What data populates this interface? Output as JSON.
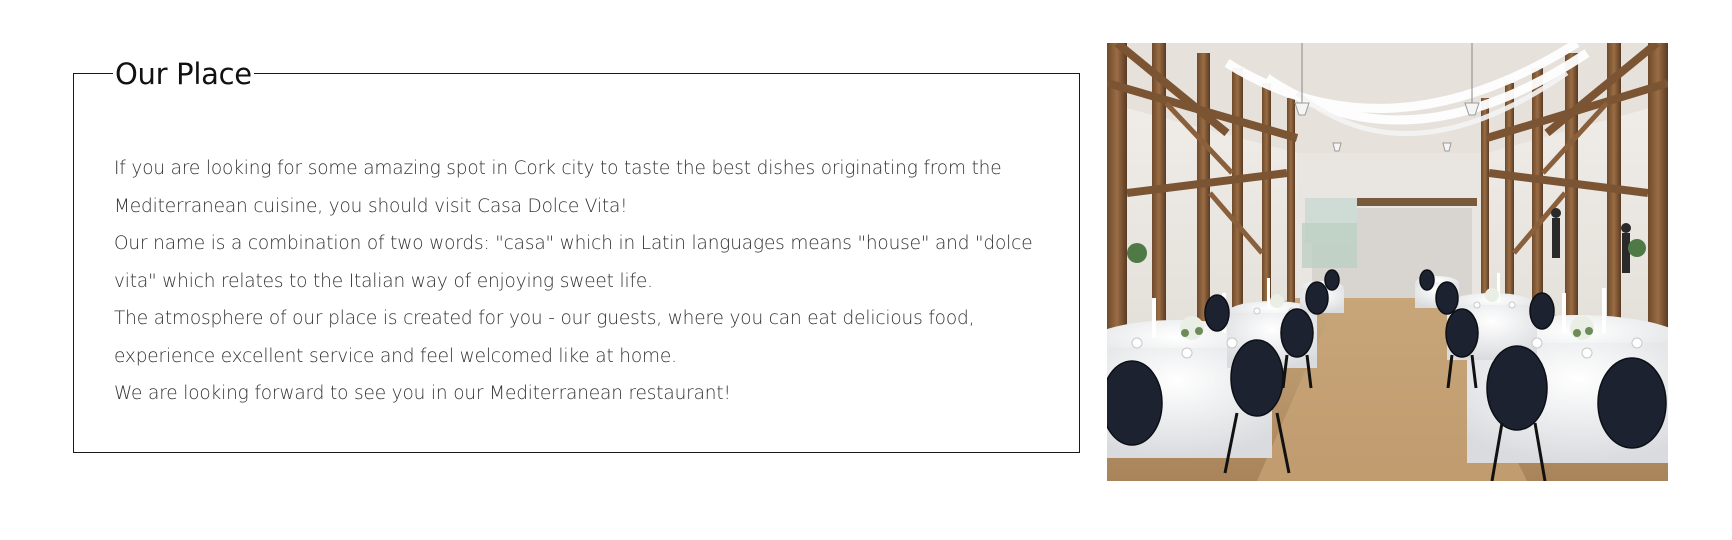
{
  "about": {
    "title": "Our Place",
    "paragraphs": [
      "If you are looking for some amazing spot in Cork city to taste the best dishes originating from the Mediterranean cuisine, you should visit Casa Dolce Vita!",
      "Our name is a combination of two words: \"casa\" which in Latin languages means \"house\" and \"dolce vita\" which relates to the Italian way of enjoying sweet life.",
      "The atmosphere of our place is created for you - our guests, where you can eat delicious food, experience excellent service and feel welcomed like at home.",
      "We are looking forward to see you in our Mediterranean restaurant!"
    ]
  },
  "image": {
    "subject": "restaurant-interior-photo"
  },
  "colors": {
    "border": "#1a1a1a",
    "text": "#333333",
    "title": "#111111",
    "background": "#ffffff"
  }
}
